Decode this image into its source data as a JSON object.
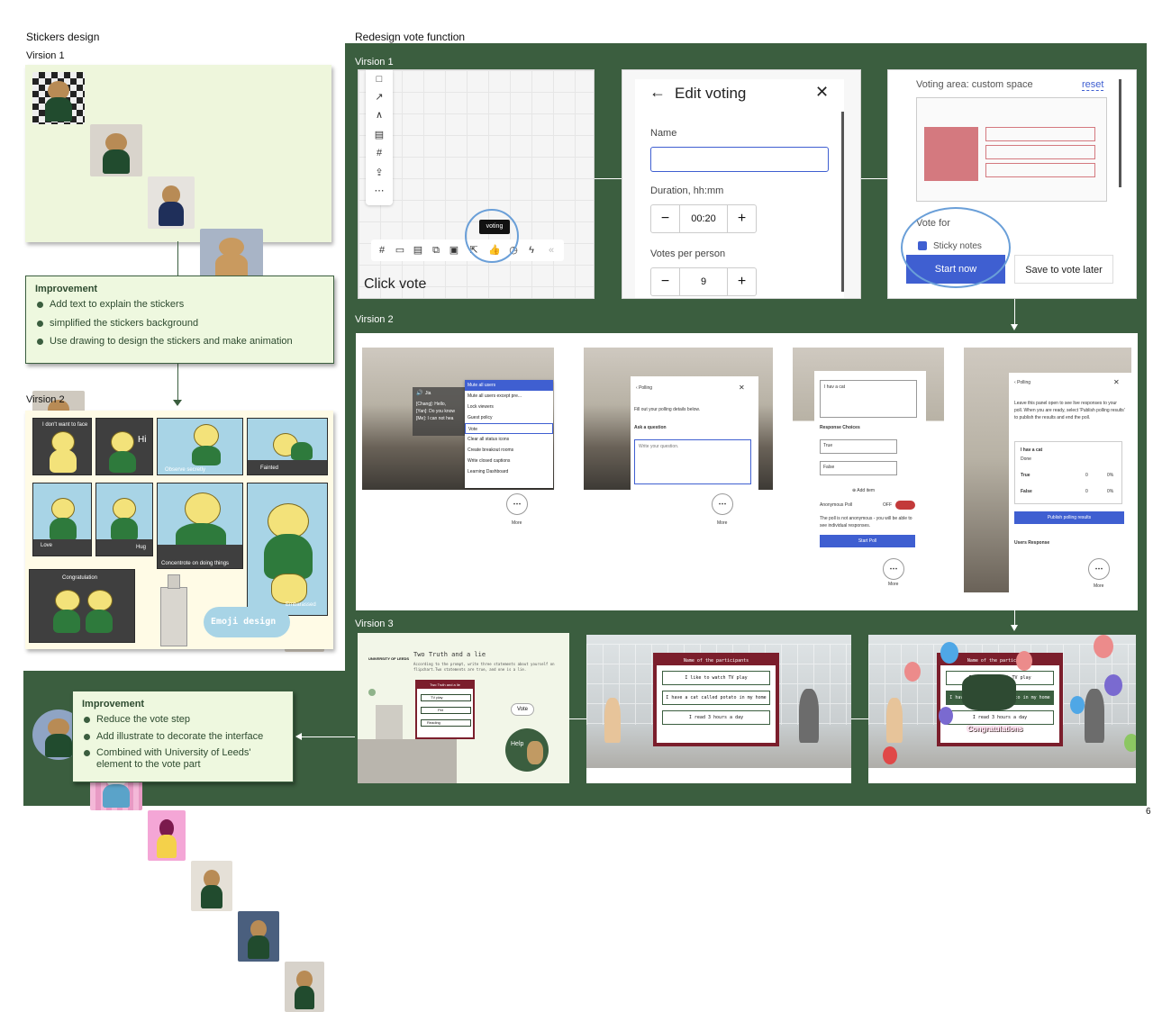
{
  "left_title": "Stickers design",
  "version1_label": "Virsion 1",
  "version2_label": "Virsion 2",
  "improvement_top": {
    "title": "Improvement",
    "items": [
      "Add text to explain the stickers",
      "simplified the stickers background",
      "Use drawing to design the stickers and make animation"
    ]
  },
  "improvement_bottom": {
    "title": "Improvement",
    "items": [
      "Reduce the vote step",
      "Add illustrate to decorate the interface",
      "Combined with University of Leeds' element to the vote part"
    ]
  },
  "stickers_v2": {
    "captions": [
      "I don't want to face",
      "Hi",
      "Observe secretly",
      "Fainted",
      "Love",
      "Hug",
      "Concentrote on doing things",
      "Embarassed",
      "Congratulation"
    ],
    "emoji_design": "Emoji design"
  },
  "right_title": "Redesign vote function",
  "rv1": {
    "label": "Virsion 1",
    "tooltip": "voting",
    "click_vote": "Click vote",
    "edit_voting": {
      "title": "Edit voting",
      "name_label": "Name",
      "duration_label": "Duration, hh:mm",
      "duration_value": "00:20",
      "votes_label": "Votes per person",
      "votes_value": "9",
      "minus": "−",
      "plus": "+"
    },
    "voting_area": {
      "title": "Voting area: custom space",
      "reset": "reset",
      "vote_for": "Vote for",
      "sticky_notes": "Sticky notes",
      "start_now": "Start now",
      "save_later": "Save to vote later"
    }
  },
  "rv2": {
    "label": "Virsion 2",
    "chat_name": "Jia",
    "chat_lines": [
      "[Chang]: Hello,",
      "[Yan]: Do you know",
      "[Me]: I can not hea"
    ],
    "menu_items": [
      "Mute all users",
      "Mute all users except pre...",
      "Lock viewers",
      "Guest policy",
      "Vote",
      "Clear all status icons",
      "Create breakout rooms",
      "Write closed captions",
      "Learning Dashboard"
    ],
    "more": "More",
    "polling": {
      "title": "Polling",
      "instructions": "Fill out your polling details below.",
      "ask": "Ask a question",
      "placeholder": "Write your question."
    },
    "poll_setup": {
      "question": "I hav a cat",
      "response_choices": "Response Choices",
      "choices": [
        "True",
        "False"
      ],
      "add_item": "⊕ Add item",
      "anonymous": "Anonymous Poll",
      "off": "OFF",
      "anon_note": "The poll is not anonymous - you will be able to see individual responses.",
      "start_poll": "Start Poll"
    },
    "poll_results": {
      "title": "Polling",
      "desc": "Leave this panel open to see live responses to your poll. When you are ready, select 'Publish polling results' to publish the results and end the poll.",
      "question": "I hav a cat",
      "done": "Done",
      "rows": [
        {
          "label": "True",
          "count": "0",
          "pct": "0%"
        },
        {
          "label": "False",
          "count": "0",
          "pct": "0%"
        }
      ],
      "publish": "Publish polling results",
      "users_response": "Users Response"
    }
  },
  "rv3": {
    "label": "Virsion 3",
    "university": "UNIVERSITY OF LEEDS",
    "game_title": "Two Truth and a lie",
    "game_desc": "According to the prompt, write three statements about yourself on flipchart.Two statements are true, and one is a lie.",
    "mini_card_title": "Two Truth and a lie",
    "mini_rows": [
      "TV play",
      "Pet",
      "Reading"
    ],
    "vote": "Vote",
    "help": "Help",
    "card_title": "Name of the participants",
    "statements": [
      "I like to watch TV play",
      "I have a cat called potato in my home",
      "I read 3 hours a day"
    ],
    "congrats": "Congratulations"
  },
  "page_number": "6",
  "colors": {
    "green": "#3b5e3f",
    "light_green": "#eef8df",
    "blue": "#3f5fd1",
    "maroon": "#7b1e2c"
  }
}
